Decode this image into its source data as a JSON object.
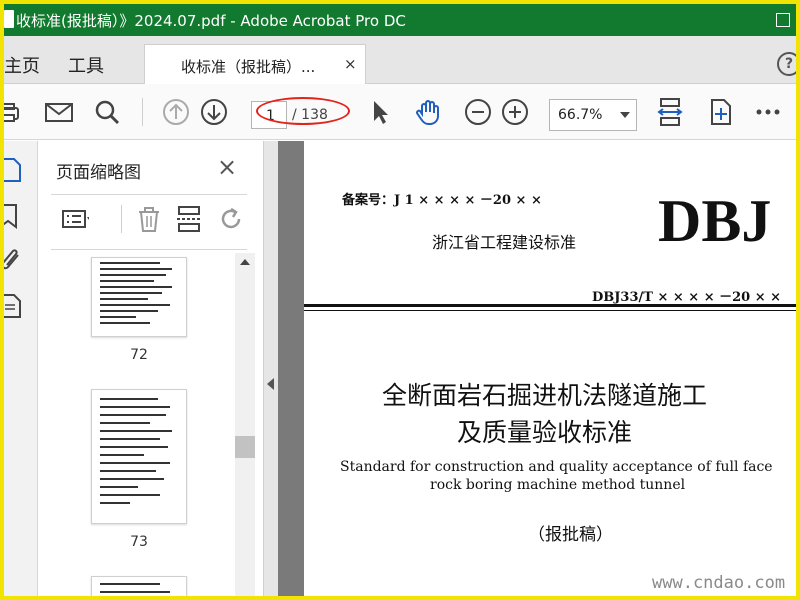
{
  "window": {
    "title": "收标准(报批稿）》2024.07.pdf - Adobe Acrobat Pro DC"
  },
  "tabs": {
    "home": "主页",
    "tools": "工具",
    "document_tab": "收标准（报批稿）...",
    "close": "×",
    "help": "?"
  },
  "toolbar": {
    "current_page": "1",
    "page_total": "/ 138",
    "zoom": "66.7%"
  },
  "thumbnail_panel": {
    "title": "页面缩略图",
    "close": "×",
    "pages": [
      "72",
      "73"
    ]
  },
  "document": {
    "record_number": "备案号：J 1 × × × × －20 × ×",
    "province_standard": "浙江省工程建设标准",
    "logo": "DBJ",
    "standard_number": "DBJ33/T × × × × －20 × ×",
    "title_cn_line1": "全断面岩石掘进机法隧道施工",
    "title_cn_line2": "及质量验收标准",
    "title_en_line1": "Standard for construction and quality acceptance of full face",
    "title_en_line2": "rock boring machine method tunnel",
    "status": "（报批稿）"
  },
  "watermark": "www.cndao.com",
  "colors": {
    "title_bar": "#127a2f",
    "border": "#f1e400",
    "highlight_oval": "#e2231a",
    "accent_blue": "#1f5fbf"
  }
}
